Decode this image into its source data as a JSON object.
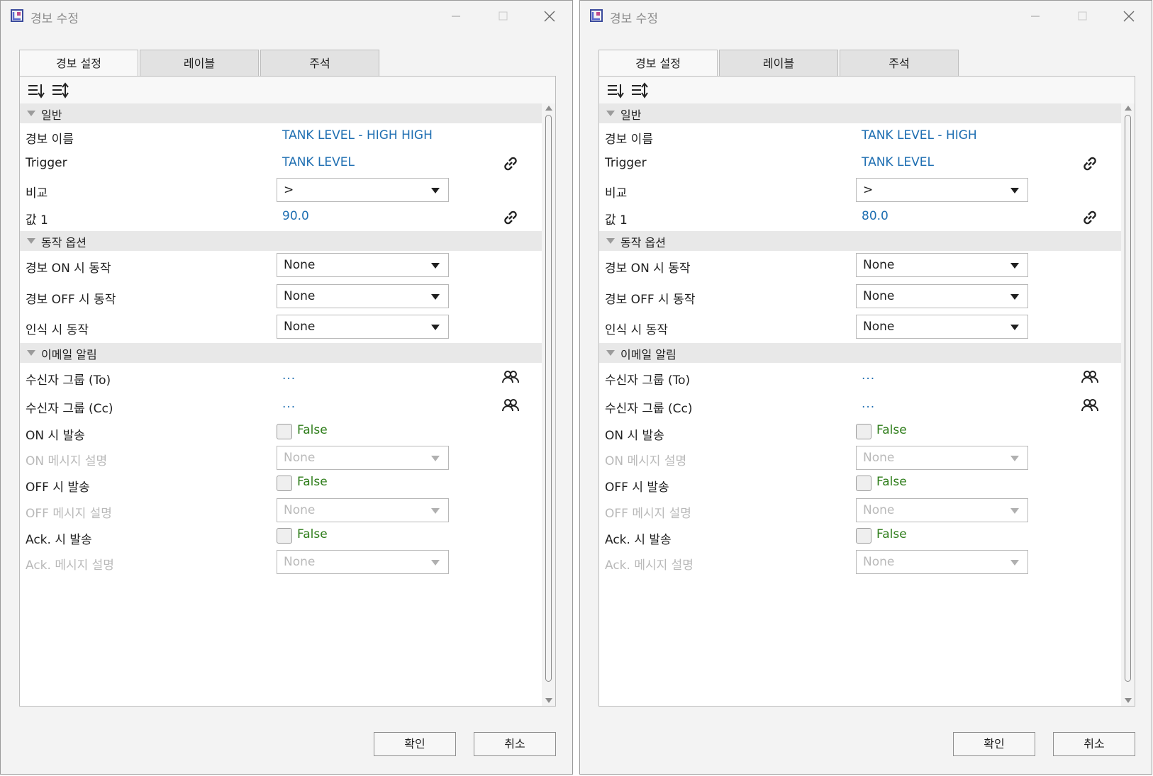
{
  "dialogs": [
    {
      "title": "경보 수정",
      "tabs": [
        "경보 설정",
        "레이블",
        "주석"
      ],
      "sections": {
        "general": "일반",
        "actions": "동작 옵션",
        "email": "이메일 알림"
      },
      "general": {
        "alarm_name_label": "경보 이름",
        "alarm_name": "TANK LEVEL - HIGH HIGH",
        "trigger_label": "Trigger",
        "trigger": "TANK LEVEL",
        "compare_label": "비교",
        "compare": ">",
        "value1_label": "값 1",
        "value1": "90.0"
      },
      "actions": {
        "on_label": "경보 ON 시 동작",
        "on_value": "None",
        "off_label": "경보 OFF 시 동작",
        "off_value": "None",
        "ack_label": "인식 시 동작",
        "ack_value": "None"
      },
      "email": {
        "to_label": "수신자 그룹 (To)",
        "to_value": "...",
        "cc_label": "수신자 그룹 (Cc)",
        "cc_value": "...",
        "send_on_label": "ON 시 발송",
        "send_on_value": "False",
        "on_msg_label": "ON 메시지 설명",
        "on_msg_value": "None",
        "send_off_label": "OFF 시 발송",
        "send_off_value": "False",
        "off_msg_label": "OFF 메시지 설명",
        "off_msg_value": "None",
        "send_ack_label": "Ack. 시 발송",
        "send_ack_value": "False",
        "ack_msg_label": "Ack. 메시지 설명",
        "ack_msg_value": "None"
      },
      "buttons": {
        "ok": "확인",
        "cancel": "취소"
      }
    },
    {
      "title": "경보 수정",
      "tabs": [
        "경보 설정",
        "레이블",
        "주석"
      ],
      "sections": {
        "general": "일반",
        "actions": "동작 옵션",
        "email": "이메일 알림"
      },
      "general": {
        "alarm_name_label": "경보 이름",
        "alarm_name": "TANK LEVEL - HIGH",
        "trigger_label": "Trigger",
        "trigger": "TANK LEVEL",
        "compare_label": "비교",
        "compare": ">",
        "value1_label": "값 1",
        "value1": "80.0"
      },
      "actions": {
        "on_label": "경보 ON 시 동작",
        "on_value": "None",
        "off_label": "경보 OFF 시 동작",
        "off_value": "None",
        "ack_label": "인식 시 동작",
        "ack_value": "None"
      },
      "email": {
        "to_label": "수신자 그룹 (To)",
        "to_value": "...",
        "cc_label": "수신자 그룹 (Cc)",
        "cc_value": "...",
        "send_on_label": "ON 시 발송",
        "send_on_value": "False",
        "on_msg_label": "ON 메시지 설명",
        "on_msg_value": "None",
        "send_off_label": "OFF 시 발송",
        "send_off_value": "False",
        "off_msg_label": "OFF 메시지 설명",
        "off_msg_value": "None",
        "send_ack_label": "Ack. 시 발송",
        "send_ack_value": "False",
        "ack_msg_label": "Ack. 메시지 설명",
        "ack_msg_value": "None"
      },
      "buttons": {
        "ok": "확인",
        "cancel": "취소"
      }
    }
  ],
  "colors": {
    "value_text": "#1f6fb2",
    "boolean_text": "#2e7d1a",
    "disabled_text": "#b9b9b9",
    "section_bg": "#e8e8e8"
  },
  "icons": {
    "app": "app-icon",
    "minimize": "minimize-icon",
    "maximize": "maximize-icon",
    "close": "close-icon",
    "categorized_sort": "sort-categorized-icon",
    "alphabetical_sort": "sort-alphabetical-icon",
    "link": "link-icon",
    "people": "people-icon",
    "collapse": "collapse-triangle-icon"
  }
}
